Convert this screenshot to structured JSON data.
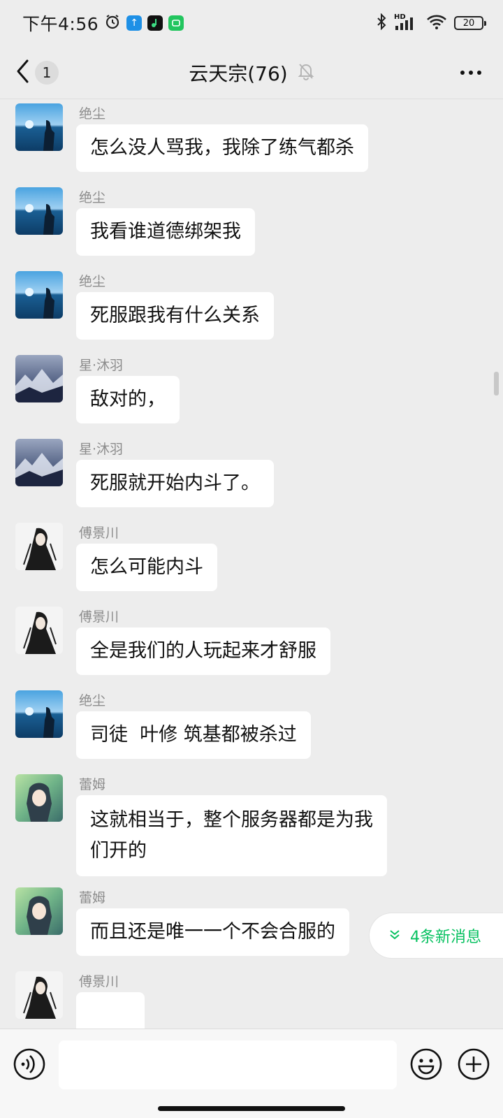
{
  "status_bar": {
    "time": "下午4:56",
    "network": "HD",
    "battery": "20",
    "icons": [
      "alarm-icon",
      "upload-app-icon",
      "music-app-icon",
      "messenger-app-icon",
      "bluetooth-icon",
      "signal-icon",
      "wifi-icon",
      "battery-icon"
    ]
  },
  "header": {
    "back_count": "1",
    "title": "云天宗(76)",
    "icons": [
      "back-chevron-icon",
      "mute-bell-icon",
      "more-dots-icon"
    ]
  },
  "messages": [
    {
      "sender": "绝尘",
      "text": "怎么没人骂我，我除了练气都杀",
      "avatar": "sea"
    },
    {
      "sender": "绝尘",
      "text": "我看谁道德绑架我",
      "avatar": "sea"
    },
    {
      "sender": "绝尘",
      "text": "死服跟我有什么关系",
      "avatar": "sea"
    },
    {
      "sender": "星·沐羽",
      "text": "敌对的，",
      "avatar": "mountain"
    },
    {
      "sender": "星·沐羽",
      "text": "死服就开始内斗了。",
      "avatar": "mountain"
    },
    {
      "sender": "傅景川",
      "text": "怎么可能内斗",
      "avatar": "swordsman"
    },
    {
      "sender": "傅景川",
      "text": "全是我们的人玩起来才舒服",
      "avatar": "swordsman"
    },
    {
      "sender": "绝尘",
      "text": "司徒  叶修 筑基都被杀过",
      "avatar": "sea"
    },
    {
      "sender": "蕾姆",
      "text_lines": [
        "这就相当于，整个服务器都是为我",
        "们开的"
      ],
      "avatar": "anime"
    },
    {
      "sender": "蕾姆",
      "text": "而且还是唯一一个不会合服的",
      "avatar": "anime"
    },
    {
      "sender": "傅景川",
      "text": "",
      "avatar": "swordsman"
    }
  ],
  "new_messages": {
    "label": "4条新消息",
    "icon": "double-chevron-down-icon",
    "accent": "#07c160"
  },
  "input_bar": {
    "value": "",
    "icons": [
      "voice-icon",
      "emoji-icon",
      "plus-icon"
    ]
  },
  "colors": {
    "background": "#ededed",
    "bubble": "#ffffff",
    "sender_name": "#8c8c8c",
    "accent": "#07c160"
  }
}
